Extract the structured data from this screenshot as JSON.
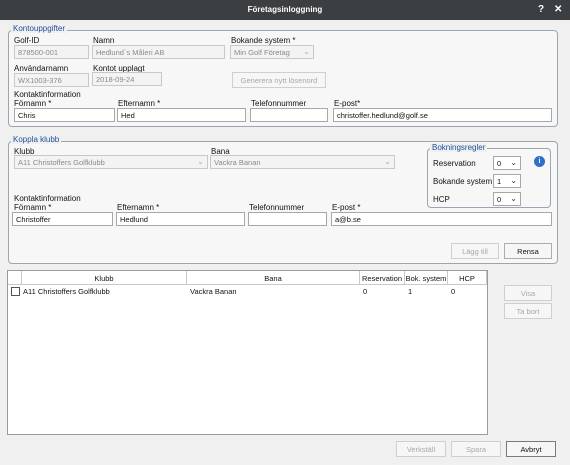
{
  "window": {
    "title": "Företagsinloggning",
    "help_label": "?",
    "close_label": "✕"
  },
  "account": {
    "legend": "Kontouppgifter",
    "golf_id_label": "Golf-ID",
    "golf_id": "878500-001",
    "name_label": "Namn",
    "name": "Hedlund´s Måleri AB",
    "booking_system_label": "Bokande system *",
    "booking_system": "Min Golf Företag",
    "username_label": "Användarnamn",
    "username": "WX1003-376",
    "created_label": "Kontot upplagt",
    "created": "2018-09-24",
    "generate_password_label": "Generera nytt lösenord",
    "contact_label": "Kontaktinformation",
    "first_name_label": "Förnamn *",
    "first_name": "Chris",
    "last_name_label": "Efternamn *",
    "last_name": "Hed",
    "phone_label": "Telefonnummer",
    "phone": "",
    "email_label": "E-post*",
    "email": "christoffer.hedlund@golf.se"
  },
  "club": {
    "legend": "Koppla klubb",
    "club_label": "Klubb",
    "club": "A11 Christoffers Golfklubb",
    "course_label": "Bana",
    "course": "Vackra Banan",
    "rules_legend": "Bokningsregler",
    "reservation_label": "Reservation",
    "reservation": "0",
    "booking_system_label": "Bokande system",
    "booking_system": "1",
    "hcp_label": "HCP",
    "hcp": "0",
    "contact_label": "Kontaktinformation",
    "first_name_label": "Förnamn *",
    "first_name": "Christoffer",
    "last_name_label": "Efternamn *",
    "last_name": "Hedlund",
    "phone_label": "Telefonnummer",
    "phone": "",
    "email_label": "E-post *",
    "email": "a@b.se",
    "add_label": "Lägg till",
    "clear_label": "Rensa"
  },
  "table": {
    "columns": [
      "Klubb",
      "Bana",
      "Reservation",
      "Bok. system",
      "HCP"
    ],
    "rows": [
      {
        "club": "A11 Christoffers Golfklubb",
        "course": "Vackra Banan",
        "reservation": "0",
        "booking_system": "1",
        "hcp": "0"
      }
    ]
  },
  "side_buttons": {
    "view_label": "Visa",
    "delete_label": "Ta bort"
  },
  "footer": {
    "apply_label": "Verkställ",
    "save_label": "Spara",
    "cancel_label": "Avbryt"
  },
  "colors": {
    "titlebar": "#3c3f41",
    "legend": "#1f4e9a",
    "help_icon": "#2f6fc7"
  }
}
